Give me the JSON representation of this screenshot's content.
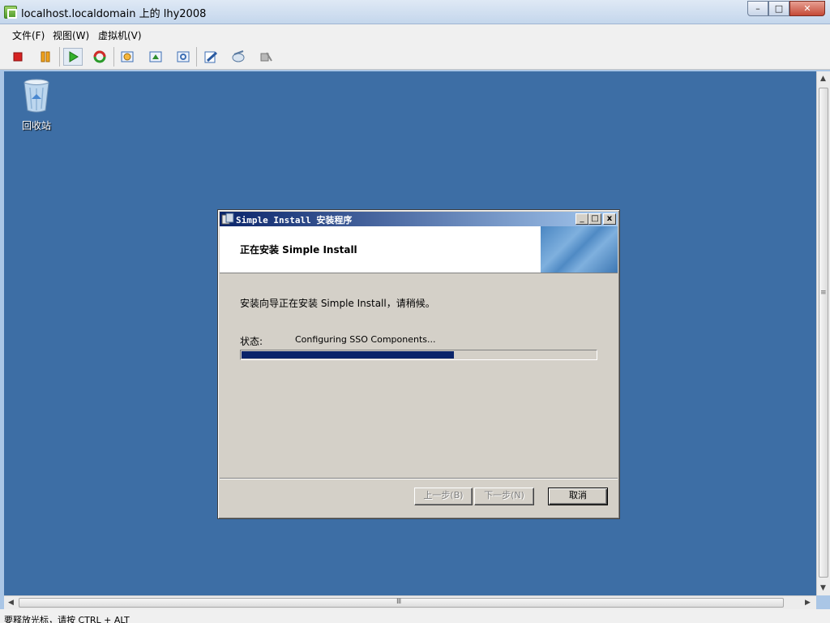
{
  "window": {
    "title": "localhost.localdomain 上的 lhy2008",
    "minimize": "–",
    "maximize": "□",
    "close": "✕"
  },
  "menu": {
    "file": "文件(F)",
    "view": "视图(W)",
    "vm": "虚拟机(V)"
  },
  "toolbar": {
    "icons": [
      "stop-icon",
      "pause-icon",
      "play-icon",
      "refresh-icon",
      "snapshot-icon",
      "revert-snapshot-icon",
      "manage-snapshot-icon",
      "edit-settings-icon",
      "cd-icon",
      "usb-icon"
    ]
  },
  "desktop": {
    "background": "#3d6ea5",
    "recycle_bin_label": "回收站"
  },
  "dialog": {
    "title": "Simple Install 安装程序",
    "min": "_",
    "max": "□",
    "close": "x",
    "heading": "正在安装 Simple Install",
    "message": "安装向导正在安装 Simple Install，请稍候。",
    "status_label": "状态:",
    "status_text": "Configuring SSO Components...",
    "progress_percent": 60,
    "buttons": {
      "back": "上一步(B)",
      "next": "下一步(N)",
      "cancel": "取消"
    }
  },
  "scrollbar": {
    "up": "▲",
    "down": "▼",
    "left": "◀",
    "right": "▶",
    "grip_v": "≡",
    "grip_h": "Ⅲ"
  },
  "statusbar": {
    "text": "要释放光标，请按 CTRL + ALT"
  }
}
